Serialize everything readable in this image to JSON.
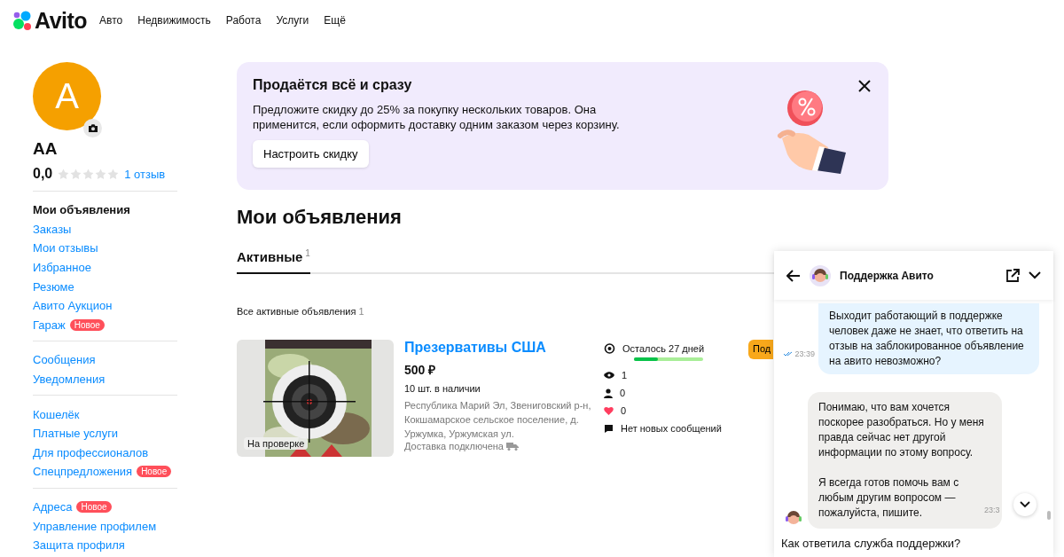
{
  "header": {
    "logo": "Avito",
    "nav": [
      "Авто",
      "Недвижимость",
      "Работа",
      "Услуги",
      "Ещё"
    ]
  },
  "profile": {
    "avatar_letter": "A",
    "name": "АА",
    "rating": "0,0",
    "stars": 0,
    "reviews": "1 отзыв"
  },
  "sidebar": {
    "groups": [
      [
        {
          "label": "Мои объявления",
          "selected": true
        },
        {
          "label": "Заказы",
          "selected": false
        },
        {
          "label": "Мои отзывы",
          "selected": false
        },
        {
          "label": "Избранное",
          "selected": false
        },
        {
          "label": "Резюме",
          "selected": false
        },
        {
          "label": "Авито Аукцион",
          "selected": false
        },
        {
          "label": "Гараж",
          "selected": false,
          "badge": "Новое"
        }
      ],
      [
        {
          "label": "Сообщения",
          "selected": false
        },
        {
          "label": "Уведомления",
          "selected": false
        }
      ],
      [
        {
          "label": "Кошелёк",
          "selected": false
        },
        {
          "label": "Платные услуги",
          "selected": false
        },
        {
          "label": "Для профессионалов",
          "selected": false
        },
        {
          "label": "Спецпредложения",
          "selected": false,
          "badge": "Новое"
        }
      ],
      [
        {
          "label": "Адреса",
          "selected": false,
          "badge": "Новое"
        },
        {
          "label": "Управление профилем",
          "selected": false
        },
        {
          "label": "Защита профиля",
          "selected": false
        }
      ]
    ]
  },
  "promo": {
    "title": "Продаётся всё и сразу",
    "text": "Предложите скидку до 25% за покупку нескольких товаров. Она применится, если оформить доставку одним заказом через корзину.",
    "button": "Настроить скидку"
  },
  "page_title": "Мои объявления",
  "tabs": [
    {
      "label": "Активные",
      "count": "1",
      "selected": true
    }
  ],
  "filter": {
    "label": "Все активные объявления",
    "count": "1"
  },
  "listing": {
    "status": "На проверке",
    "title": "Презервативы США",
    "price": "500 ₽",
    "stock": "10 шт. в наличии",
    "address": "Республика Марий Эл, Звениговский р-н, Кокшамарское сельское поселение, д. Уржумка, Уржумская ул.",
    "delivery": "Доставка подключена",
    "days_left": "Осталось 27 дней",
    "level": 0.35,
    "views": "1",
    "contacts": "0",
    "favorites": "0",
    "messages": "Нет новых сообщений",
    "button": "Под"
  },
  "chat": {
    "title": "Поддержка Авито",
    "messages": [
      {
        "kind": "me",
        "text": "Выходит работающий в поддержке человек даже не знает, что ответить на отзыв на заблокированное объявление на авито невозможно?",
        "time": "23:39",
        "read": true
      },
      {
        "kind": "support",
        "text": "Понимаю, что вам хочется поскорее разобраться. Но у меня правда сейчас нет другой информации по этому вопросу.\n\nЯ всегда готов помочь вам с любым другим вопросом — пожалуйста, пишите.",
        "time": "23:3"
      }
    ],
    "input_placeholder": "Как ответила служба поддержки?"
  }
}
